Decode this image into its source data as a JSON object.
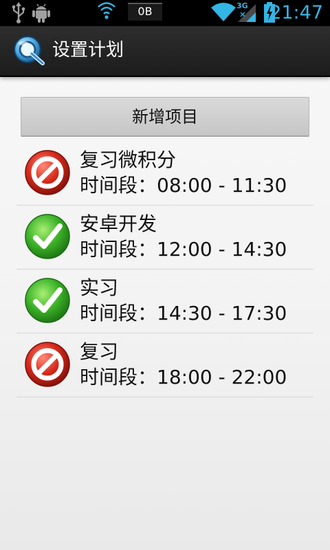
{
  "status_bar": {
    "net_speed": "0B",
    "time": "21:47",
    "network_type_label": "3G",
    "icons": [
      "usb-icon",
      "android-debug-icon",
      "wifi-signal-icon",
      "wifi-icon",
      "cell-signal-icon",
      "battery-charging-icon"
    ]
  },
  "action_bar": {
    "title": "设置计划",
    "logo_icon": "app-logo-icon"
  },
  "main": {
    "add_button_label": "新增项目",
    "plans": [
      {
        "name": "复习微积分",
        "time": "时间段：08:00 - 11:30",
        "status": "inactive",
        "icon": "cancel-icon"
      },
      {
        "name": "安卓开发",
        "time": "时间段：12:00 - 14:30",
        "status": "active",
        "icon": "check-icon"
      },
      {
        "name": "实习",
        "time": "时间段：14:30 - 17:30",
        "status": "active",
        "icon": "check-icon"
      },
      {
        "name": "复习",
        "time": "时间段：18:00 - 22:00",
        "status": "inactive",
        "icon": "cancel-icon"
      }
    ]
  },
  "colors": {
    "clock_accent": "#33b5e5",
    "action_bar_bg": "#2a2a2a",
    "active_green": "#3fb52a",
    "inactive_red": "#d72b1c"
  }
}
